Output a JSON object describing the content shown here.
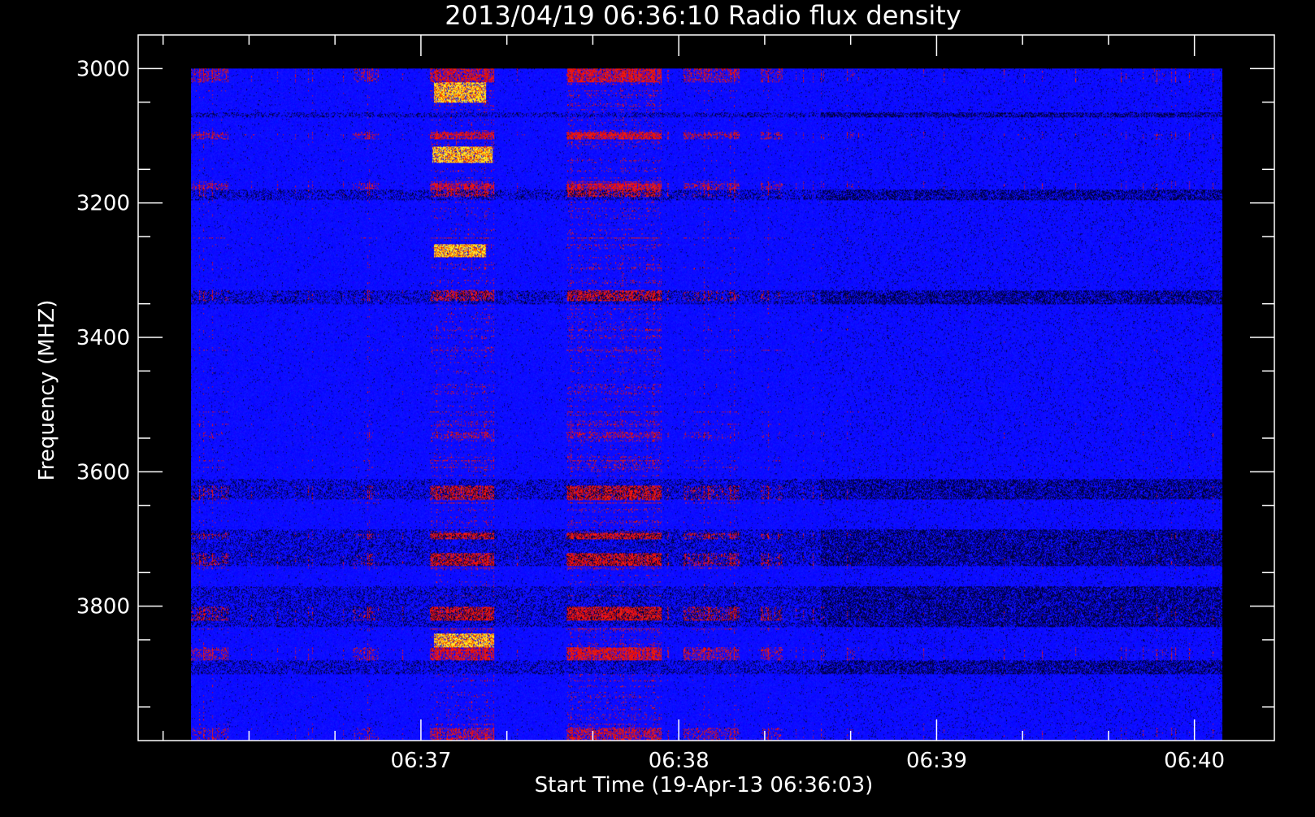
{
  "chart_data": {
    "type": "heatmap",
    "title": "2013/04/19 06:36:10 Radio flux density",
    "xlabel": "Start Time (19-Apr-13 06:36:03)",
    "ylabel": "Frequency (MHZ)",
    "x_tick_labels": [
      "06:37",
      "06:38",
      "06:39",
      "06:40"
    ],
    "x_tick_values_sec": [
      57,
      117,
      177,
      237
    ],
    "y_tick_labels": [
      "3000",
      "3200",
      "3400",
      "3600",
      "3800"
    ],
    "y_tick_values": [
      3000,
      3200,
      3400,
      3600,
      3800
    ],
    "xlim_sec": [
      -8.8,
      255.6
    ],
    "ylim": [
      2950,
      4000
    ],
    "data_time_range_sec": [
      3.5,
      243.5
    ],
    "data_freq_range": [
      3000,
      4000
    ],
    "colors": {
      "background": "#000000",
      "axes": "#ffffff",
      "low": "#000000",
      "base": "#0000ff",
      "mid": "#cc1a00",
      "high": "#ffff30"
    },
    "bright_bursts": [
      {
        "time_start_sec": 59.5,
        "time_end_sec": 73.5,
        "freq_start": 3115,
        "freq_end": 3140
      },
      {
        "time_start_sec": 60,
        "time_end_sec": 72,
        "freq_start": 3260,
        "freq_end": 3280
      },
      {
        "time_start_sec": 60,
        "time_end_sec": 72,
        "freq_start": 3020,
        "freq_end": 3050
      },
      {
        "time_start_sec": 60,
        "time_end_sec": 74,
        "freq_start": 3840,
        "freq_end": 3860
      }
    ],
    "active_time_bands_sec": [
      {
        "start": 3.5,
        "end": 12,
        "level": 0.45
      },
      {
        "start": 41,
        "end": 47,
        "level": 0.4
      },
      {
        "start": 59,
        "end": 74,
        "level": 0.7
      },
      {
        "start": 91,
        "end": 113,
        "level": 0.75
      },
      {
        "start": 118,
        "end": 131,
        "level": 0.5
      },
      {
        "start": 136,
        "end": 141,
        "level": 0.45
      },
      {
        "start": 156,
        "end": 158,
        "level": 0.35
      },
      {
        "start": 227,
        "end": 231,
        "level": 0.3
      }
    ],
    "active_freq_bands_mhz": [
      {
        "start": 3000,
        "end": 3020,
        "level": 0.6
      },
      {
        "start": 3095,
        "end": 3105,
        "level": 0.6
      },
      {
        "start": 3170,
        "end": 3190,
        "level": 0.6
      },
      {
        "start": 3330,
        "end": 3345,
        "level": 0.65
      },
      {
        "start": 3540,
        "end": 3550,
        "level": 0.4
      },
      {
        "start": 3620,
        "end": 3640,
        "level": 0.7
      },
      {
        "start": 3690,
        "end": 3700,
        "level": 0.75
      },
      {
        "start": 3720,
        "end": 3740,
        "level": 0.75
      },
      {
        "start": 3800,
        "end": 3820,
        "level": 0.8
      },
      {
        "start": 3860,
        "end": 3880,
        "level": 0.6
      },
      {
        "start": 3980,
        "end": 4000,
        "level": 0.5
      }
    ],
    "dark_freq_bands_mhz": [
      {
        "start": 3065,
        "end": 3072
      },
      {
        "start": 3180,
        "end": 3195
      },
      {
        "start": 3330,
        "end": 3350
      },
      {
        "start": 3610,
        "end": 3640
      },
      {
        "start": 3685,
        "end": 3740
      },
      {
        "start": 3770,
        "end": 3830
      },
      {
        "start": 3880,
        "end": 3900
      }
    ]
  }
}
